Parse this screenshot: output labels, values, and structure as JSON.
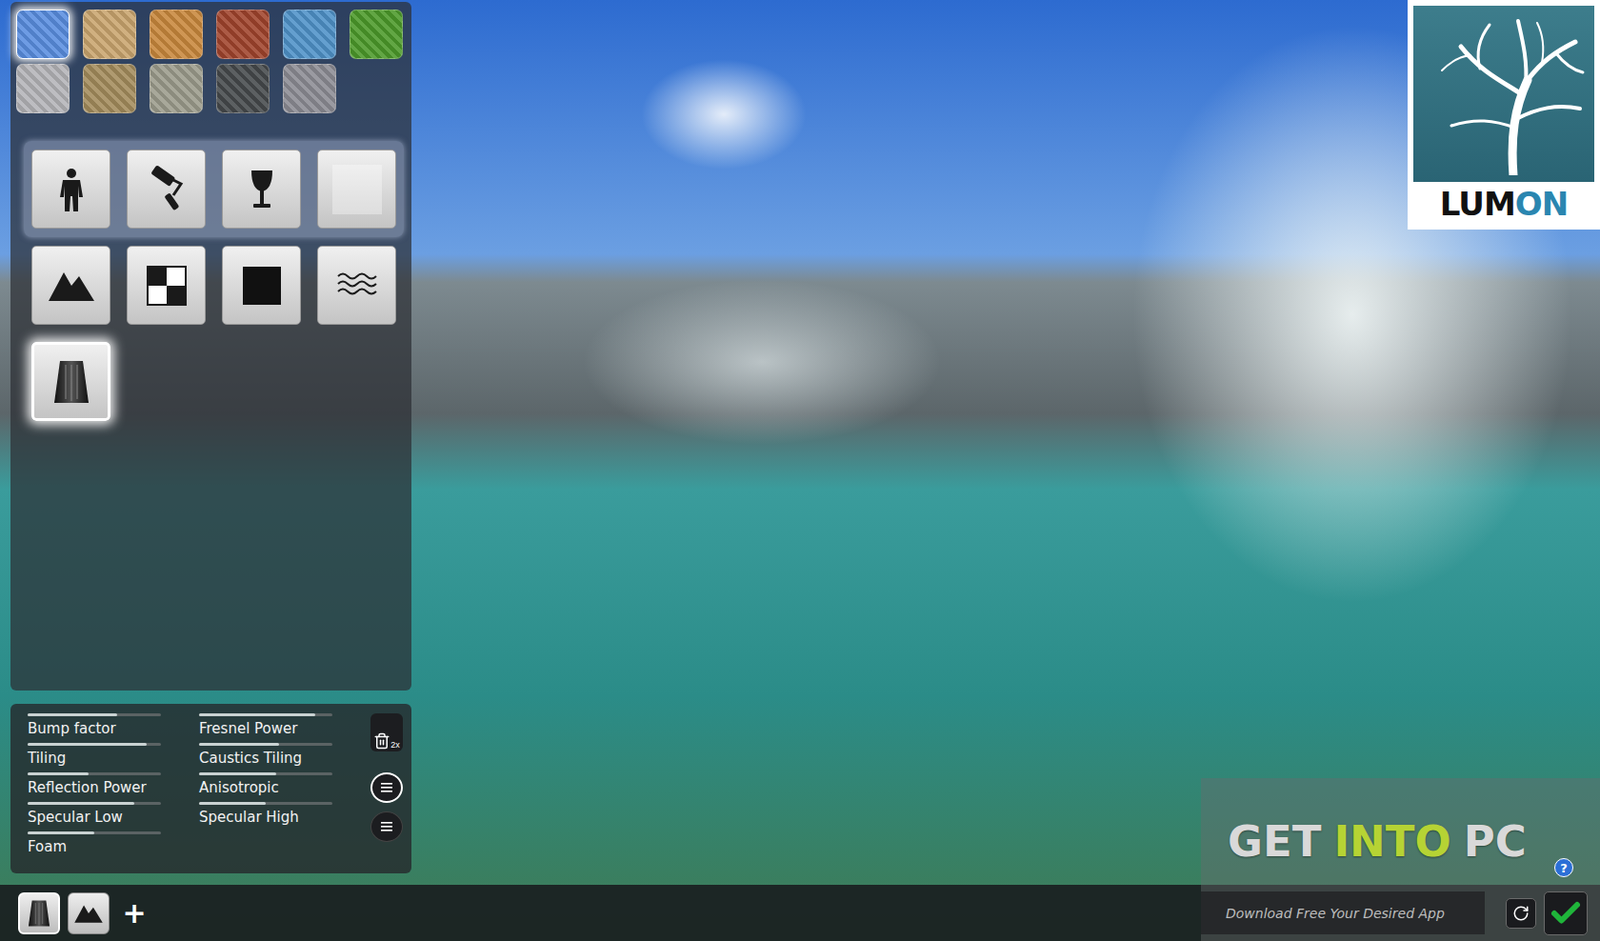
{
  "materials": [
    {
      "color": "#5a8ee0",
      "selected": true
    },
    {
      "color": "#c9a56e",
      "selected": false
    },
    {
      "color": "#c8883c",
      "selected": false
    },
    {
      "color": "#a0442c",
      "selected": false
    },
    {
      "color": "#4f92c8",
      "selected": false
    },
    {
      "color": "#4c9a2a",
      "selected": false
    },
    {
      "color": "#b4b4b8",
      "selected": false
    },
    {
      "color": "#a48c5c",
      "selected": false
    },
    {
      "color": "#9c9c8c",
      "selected": false
    },
    {
      "color": "#464a4c",
      "selected": false
    },
    {
      "color": "#8c8c94",
      "selected": false
    }
  ],
  "category_rows": [
    {
      "highlighted": true,
      "items": [
        {
          "kind": "person",
          "selected": false
        },
        {
          "kind": "roller",
          "selected": false
        },
        {
          "kind": "goblet",
          "selected": false
        },
        {
          "kind": "blank",
          "selected": false
        }
      ]
    },
    {
      "highlighted": false,
      "items": [
        {
          "kind": "mountains",
          "selected": false
        },
        {
          "kind": "checker",
          "selected": false
        },
        {
          "kind": "square",
          "selected": false
        },
        {
          "kind": "waves",
          "selected": false
        }
      ]
    },
    {
      "highlighted": false,
      "items": [
        {
          "kind": "waterfall",
          "selected": true
        }
      ]
    }
  ],
  "properties": [
    {
      "label": "Bump factor",
      "level": 0.67
    },
    {
      "label": "Fresnel Power",
      "level": 0.87
    },
    {
      "label": "Tiling",
      "level": 0.89
    },
    {
      "label": "Caustics Tiling",
      "level": 0.6
    },
    {
      "label": "Reflection Power",
      "level": 0.46
    },
    {
      "label": "Anisotropic",
      "level": 0.58
    },
    {
      "label": "Specular Low",
      "level": 0.8
    },
    {
      "label": "Specular High",
      "level": 0.5
    },
    {
      "label": "Foam",
      "level": 0.5
    }
  ],
  "panel_buttons": [
    {
      "kind": "delete",
      "label": "2x",
      "selected": false
    },
    {
      "kind": "list",
      "selected": true
    },
    {
      "kind": "list",
      "selected": false
    }
  ],
  "layers": [
    {
      "kind": "waterfall",
      "selected": true
    },
    {
      "kind": "mountains",
      "selected": false
    }
  ],
  "add_button": {
    "label": "+"
  },
  "actions": [
    {
      "kind": "refresh"
    },
    {
      "kind": "confirm"
    }
  ],
  "logo": {
    "parts": [
      {
        "text": "LUM",
        "color": "#111111"
      },
      {
        "text": "ON",
        "color": "#2a86b0"
      }
    ]
  },
  "watermark": {
    "title_parts": [
      {
        "text": "GET",
        "color": "#d9d9d9"
      },
      {
        "text": "INTO",
        "color": "#b6d334"
      },
      {
        "text": "PC",
        "color": "#d9d9d9"
      }
    ],
    "subtitle": "Download Free Your Desired App",
    "help": "?"
  }
}
